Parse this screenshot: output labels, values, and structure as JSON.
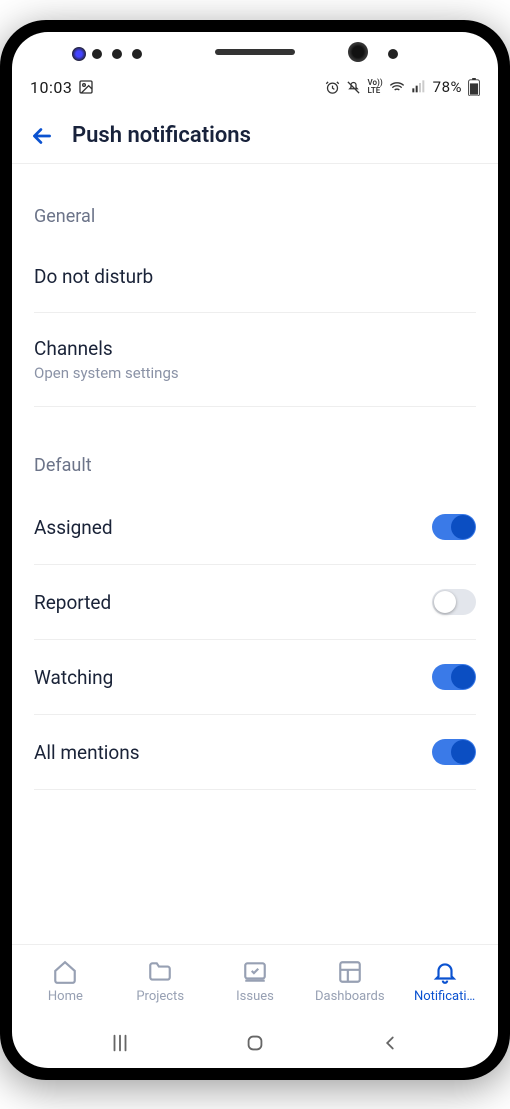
{
  "statusbar": {
    "time": "10:03",
    "battery": "78%"
  },
  "header": {
    "title": "Push notifications"
  },
  "sections": {
    "general_label": "General",
    "default_label": "Default",
    "dnd_label": "Do not disturb",
    "channels_label": "Channels",
    "channels_sub": "Open system settings",
    "assigned_label": "Assigned",
    "reported_label": "Reported",
    "watching_label": "Watching",
    "mentions_label": "All mentions"
  },
  "toggles": {
    "assigned": true,
    "reported": false,
    "watching": true,
    "mentions": true
  },
  "nav": {
    "home": "Home",
    "projects": "Projects",
    "issues": "Issues",
    "dashboards": "Dashboards",
    "notifications": "Notificati…"
  }
}
